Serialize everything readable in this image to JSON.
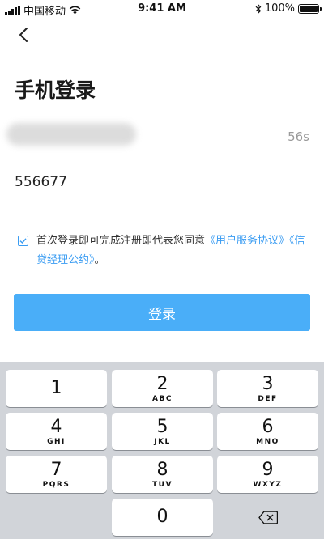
{
  "status_bar": {
    "carrier": "中国移动",
    "time": "9:41 AM",
    "battery_text": "100%",
    "battery_level": 1.0
  },
  "header": {
    "title": "手机登录"
  },
  "phone": {
    "countdown": "56s"
  },
  "code": {
    "value": "556677"
  },
  "agreement": {
    "checked": true,
    "text": "首次登录即可完成注册即代表您同意",
    "link_user": "《用户服务协议》",
    "link_credit": "《信贷经理公约》",
    "suffix": "。"
  },
  "login_button": {
    "label": "登录"
  },
  "keyboard": {
    "keys": [
      {
        "num": "1",
        "letters": ""
      },
      {
        "num": "2",
        "letters": "ABC"
      },
      {
        "num": "3",
        "letters": "DEF"
      },
      {
        "num": "4",
        "letters": "GHI"
      },
      {
        "num": "5",
        "letters": "JKL"
      },
      {
        "num": "6",
        "letters": "MNO"
      },
      {
        "num": "7",
        "letters": "PQRS"
      },
      {
        "num": "8",
        "letters": "TUV"
      },
      {
        "num": "9",
        "letters": "WXYZ"
      },
      {
        "num": "0",
        "letters": ""
      }
    ],
    "delete_icon": "backspace-icon"
  }
}
